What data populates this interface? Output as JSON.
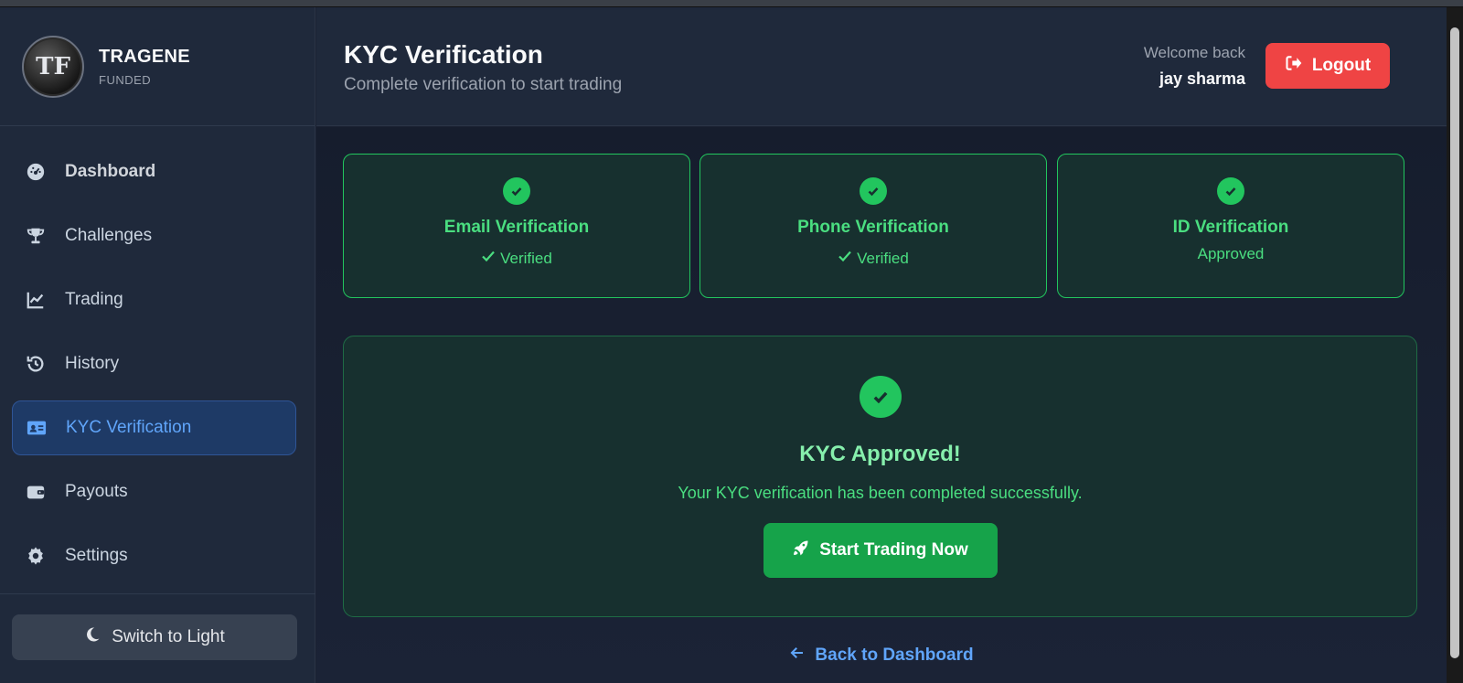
{
  "brand": {
    "logo_text": "TF",
    "name": "TRAGENE",
    "sub": "FUNDED"
  },
  "nav": {
    "items": [
      {
        "label": "Dashboard",
        "icon": "gauge-icon"
      },
      {
        "label": "Challenges",
        "icon": "trophy-icon"
      },
      {
        "label": "Trading",
        "icon": "chart-line-icon"
      },
      {
        "label": "History",
        "icon": "history-icon"
      },
      {
        "label": "KYC Verification",
        "icon": "id-card-icon"
      },
      {
        "label": "Payouts",
        "icon": "wallet-icon"
      },
      {
        "label": "Settings",
        "icon": "gear-icon"
      }
    ],
    "active": "KYC Verification"
  },
  "theme_toggle": {
    "label": "Switch to Light",
    "icon": "moon-icon"
  },
  "header": {
    "title": "KYC Verification",
    "subtitle": "Complete verification to start trading",
    "welcome_label": "Welcome back",
    "user_name": "jay sharma",
    "logout_label": "Logout"
  },
  "cards": [
    {
      "title": "Email Verification",
      "status": "Verified"
    },
    {
      "title": "Phone Verification",
      "status": "Verified"
    },
    {
      "title": "ID Verification",
      "status": "Approved"
    }
  ],
  "approved": {
    "title": "KYC Approved!",
    "message": "Your KYC verification has been completed successfully.",
    "button_label": "Start Trading Now"
  },
  "back_link": "Back to Dashboard",
  "colors": {
    "accent_green": "#22c55e",
    "accent_blue": "#60a5fa",
    "danger_red": "#ef4444",
    "sidebar_bg": "#1f293b"
  }
}
